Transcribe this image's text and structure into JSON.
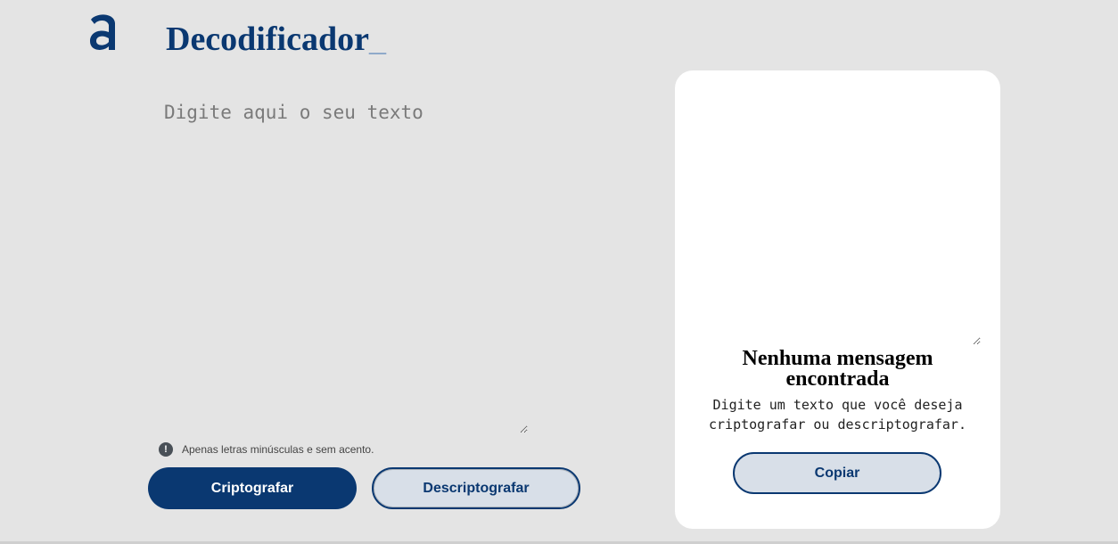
{
  "header": {
    "logo_icon": "alura-logo-icon",
    "title": "Decodificador",
    "title_cursor": "_"
  },
  "input": {
    "placeholder": "Digite aqui o seu texto",
    "value": ""
  },
  "hint": {
    "icon": "exclamation-circle-icon",
    "text": "Apenas letras minúsculas e sem acento."
  },
  "actions": {
    "encrypt_label": "Criptografar",
    "decrypt_label": "Descriptografar"
  },
  "output": {
    "value": "",
    "empty_title": "Nenhuma mensagem encontrada",
    "empty_description": "Digite um texto que você deseja criptografar ou descriptografar.",
    "copy_label": "Copiar"
  },
  "colors": {
    "primary": "#0a3871",
    "background": "#e4e4e4",
    "panel": "#ffffff",
    "secondary_button": "#d8dfe8"
  }
}
